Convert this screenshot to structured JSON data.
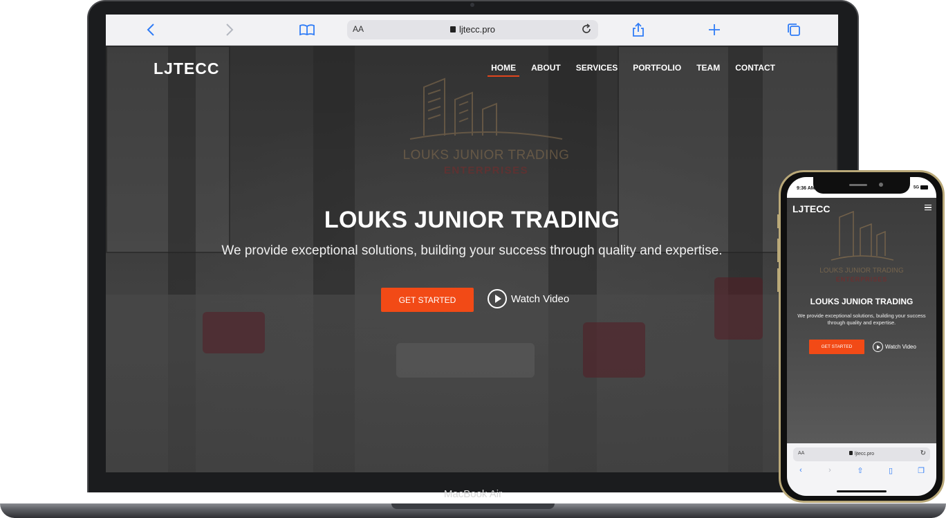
{
  "laptop": {
    "model_label": "MacBook Air",
    "browser": {
      "url": "ljtecc.pro",
      "text_size_label": "AA"
    },
    "site": {
      "logo": "LJTECC",
      "nav": [
        {
          "label": "HOME",
          "active": true
        },
        {
          "label": "ABOUT",
          "active": false
        },
        {
          "label": "SERVICES",
          "active": false
        },
        {
          "label": "PORTFOLIO",
          "active": false
        },
        {
          "label": "TEAM",
          "active": false
        },
        {
          "label": "CONTACT",
          "active": false
        }
      ],
      "watermark": {
        "line1": "LOUKS JUNIOR TRADING",
        "line2": "ENTERPRISES"
      },
      "hero_title": "LOUKS JUNIOR TRADING",
      "hero_subtitle": "We provide exceptional solutions, building your success through quality and expertise.",
      "cta_label": "GET STARTED",
      "watch_label": "Watch Video"
    }
  },
  "phone": {
    "status_time": "9:36 AM",
    "status_network": "5G",
    "browser": {
      "url": "ljtecc.pro",
      "text_size_label": "AA"
    },
    "site": {
      "logo": "LJTECC",
      "watermark": {
        "line1": "LOUKS JUNIOR TRADING",
        "line2": "ENTERPRISES"
      },
      "hero_title": "LOUKS JUNIOR TRADING",
      "hero_subtitle": "We provide exceptional solutions, building your success through quality and expertise.",
      "cta_label": "GET STARTED",
      "watch_label": "Watch Video"
    }
  },
  "colors": {
    "accent": "#f24a16",
    "safari_blue": "#2f7cf6",
    "phone_frame": "#b9a878"
  }
}
